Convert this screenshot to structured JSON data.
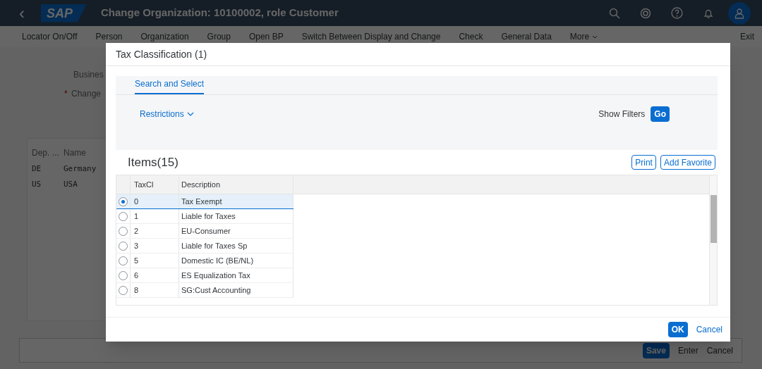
{
  "shell": {
    "back": "‹",
    "logo": "SAP",
    "title": "Change Organization: 10100002, role Customer"
  },
  "toolbar": [
    {
      "label": "Locator On/Off"
    },
    {
      "label": "Person"
    },
    {
      "label": "Organization"
    },
    {
      "label": "Group"
    },
    {
      "label": "Open BP"
    },
    {
      "label": "Switch Between Display and Change"
    },
    {
      "label": "Check"
    },
    {
      "label": "General Data"
    },
    {
      "label": "More"
    }
  ],
  "toolbar_exit": "Exit",
  "form": {
    "label_1": "Busines",
    "required_mark": "*",
    "label_2": "Change"
  },
  "background_table": {
    "columns": [
      "Dep. ...",
      "Name"
    ],
    "rows": [
      [
        "DE",
        "Germany"
      ],
      [
        "US",
        "USA"
      ]
    ]
  },
  "footer_buttons": [
    {
      "label": "Save",
      "kind": "primary"
    },
    {
      "label": "Enter",
      "kind": "plain"
    },
    {
      "label": "Cancel",
      "kind": "plain"
    }
  ],
  "dialog": {
    "title": "Tax Classification (1)",
    "tabs": [
      {
        "label": "Search and Select",
        "selected": true
      }
    ],
    "restrictions": "Restrictions",
    "show_filters": "Show Filters",
    "go": "Go",
    "items_title": "Items(15)",
    "actions": [
      "Print",
      "Add Favorite"
    ],
    "columns": [
      "TaxCl",
      "Description"
    ],
    "rows": [
      {
        "taxcl": "0",
        "description": "Tax Exempt",
        "selected": true
      },
      {
        "taxcl": "1",
        "description": "Liable for Taxes",
        "selected": false
      },
      {
        "taxcl": "2",
        "description": "EU-Consumer",
        "selected": false
      },
      {
        "taxcl": "3",
        "description": "Liable for Taxes Sp",
        "selected": false
      },
      {
        "taxcl": "5",
        "description": "Domestic IC (BE/NL)",
        "selected": false
      },
      {
        "taxcl": "6",
        "description": "ES Equalization Tax",
        "selected": false
      },
      {
        "taxcl": "8",
        "description": "SG:Cust Accounting",
        "selected": false
      }
    ],
    "ok": "OK",
    "cancel": "Cancel"
  }
}
